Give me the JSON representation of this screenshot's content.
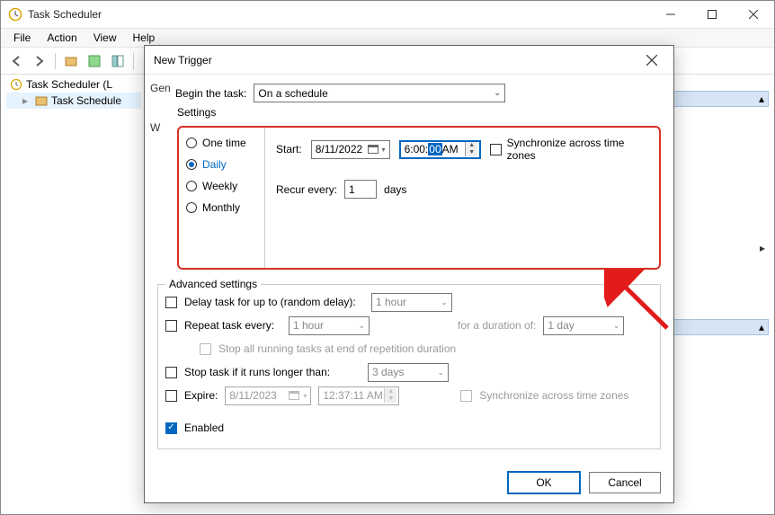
{
  "window": {
    "title": "Task Scheduler"
  },
  "menu": {
    "file": "File",
    "action": "Action",
    "view": "View",
    "help": "Help"
  },
  "tree": {
    "root": "Task Scheduler (L",
    "child": "Task Schedule"
  },
  "dialog": {
    "title": "New Trigger",
    "gen_label": "Gen",
    "w_label": "W",
    "begin_label": "Begin the task:",
    "begin_value": "On a schedule",
    "settings_legend": "Settings",
    "freq": {
      "one_time": "One time",
      "daily": "Daily",
      "weekly": "Weekly",
      "monthly": "Monthly",
      "selected": "daily"
    },
    "start_label": "Start:",
    "start_date": "8/11/2022",
    "start_time_prefix": "6:00:",
    "start_time_sel": "00",
    "start_time_suffix": " AM",
    "sync_tz": "Synchronize across time zones",
    "recur_label": "Recur every:",
    "recur_value": "1",
    "recur_unit": "days",
    "advanced_legend": "Advanced settings",
    "delay_label": "Delay task for up to (random delay):",
    "delay_value": "1 hour",
    "repeat_label": "Repeat task every:",
    "repeat_value": "1 hour",
    "duration_label": "for a duration of:",
    "duration_value": "1 day",
    "stop_all_label": "Stop all running tasks at end of repetition duration",
    "stop_longer_label": "Stop task if it runs longer than:",
    "stop_longer_value": "3 days",
    "expire_label": "Expire:",
    "expire_date": "8/11/2023",
    "expire_time": "12:37:11 AM",
    "sync_tz_2": "Synchronize across time zones",
    "enabled_label": "Enabled",
    "ok": "OK",
    "cancel": "Cancel"
  }
}
